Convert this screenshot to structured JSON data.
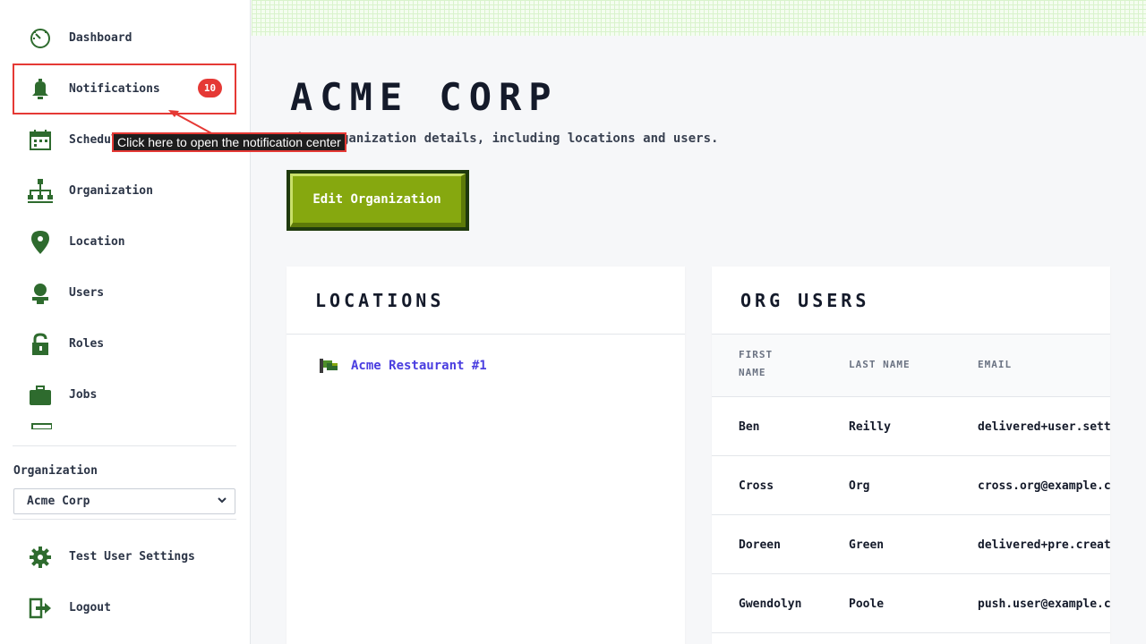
{
  "sidebar": {
    "items": [
      {
        "id": "dashboard",
        "label": "Dashboard",
        "icon": "dashboard-icon"
      },
      {
        "id": "notifications",
        "label": "Notifications",
        "icon": "bell-icon",
        "badge": "10"
      },
      {
        "id": "schedule",
        "label": "Schedule",
        "icon": "calendar-icon"
      },
      {
        "id": "organization",
        "label": "Organization",
        "icon": "org-chart-icon"
      },
      {
        "id": "location",
        "label": "Location",
        "icon": "map-pin-icon"
      },
      {
        "id": "users",
        "label": "Users",
        "icon": "user-icon"
      },
      {
        "id": "roles",
        "label": "Roles",
        "icon": "lock-icon"
      },
      {
        "id": "jobs",
        "label": "Jobs",
        "icon": "briefcase-icon"
      }
    ],
    "org_label": "Organization",
    "org_selected": "Acme Corp",
    "bottom_items": [
      {
        "id": "test-user-settings",
        "label": "Test User Settings",
        "icon": "gear-icon"
      },
      {
        "id": "logout",
        "label": "Logout",
        "icon": "logout-icon"
      }
    ]
  },
  "tooltip": {
    "text": "Click here to open the notification center"
  },
  "main": {
    "title": "ACME CORP",
    "subtitle": "View organization details, including locations and users.",
    "edit_button": "Edit Organization"
  },
  "locations": {
    "title": "LOCATIONS",
    "items": [
      {
        "name": "Acme Restaurant #1",
        "icon": "location-flag-icon"
      }
    ]
  },
  "org_users": {
    "title": "ORG USERS",
    "headers": {
      "first": "FIRST NAME",
      "last": "LAST NAME",
      "email": "EMAIL"
    },
    "rows": [
      {
        "first": "Ben",
        "last": "Reilly",
        "email": "delivered+user.settin"
      },
      {
        "first": "Cross",
        "last": "Org",
        "email": "cross.org@example.com"
      },
      {
        "first": "Doreen",
        "last": "Green",
        "email": "delivered+pre.created"
      },
      {
        "first": "Gwendolyn",
        "last": "Poole",
        "email": "push.user@example.com"
      }
    ]
  },
  "colors": {
    "accent": "#86a80f",
    "accent_dark": "#1f3a0d",
    "icon_green": "#2e6b2e",
    "link": "#4a3ee0",
    "badge": "#e53935"
  }
}
